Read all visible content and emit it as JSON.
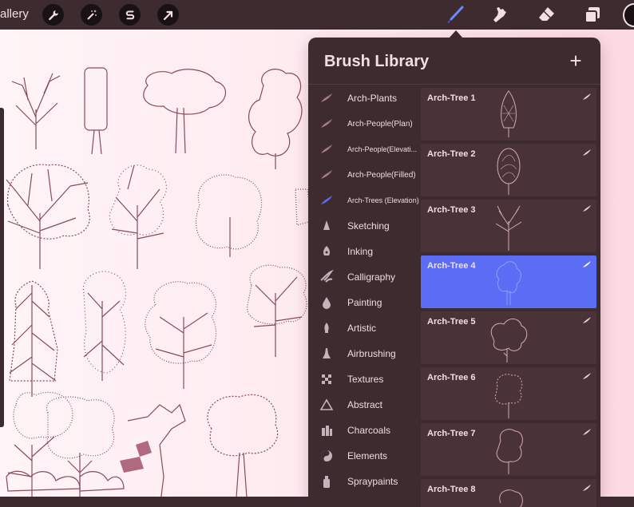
{
  "topbar": {
    "gallery_label": "allery",
    "left_icons": [
      "wrench-icon",
      "magic-wand-icon",
      "selection-s-icon",
      "arrow-cursor-icon"
    ],
    "right_icons": [
      "brush-icon",
      "smudge-icon",
      "eraser-icon",
      "layers-icon"
    ]
  },
  "panel": {
    "title": "Brush Library",
    "add_label": "+"
  },
  "categories": [
    {
      "label": "Arch-Plants",
      "icon": "brush-stroke-icon"
    },
    {
      "label": "Arch-People(Plan)",
      "icon": "brush-stroke-icon"
    },
    {
      "label": "Arch-People(Elevati...",
      "icon": "brush-stroke-icon"
    },
    {
      "label": "Arch-People(Filled)",
      "icon": "brush-stroke-icon"
    },
    {
      "label": "Arch-Trees (Elevation)",
      "icon": "brush-stroke-icon"
    },
    {
      "label": "Sketching",
      "icon": "pencil-tip-icon"
    },
    {
      "label": "Inking",
      "icon": "ink-nib-icon"
    },
    {
      "label": "Calligraphy",
      "icon": "calligraphy-icon"
    },
    {
      "label": "Painting",
      "icon": "paint-drop-icon"
    },
    {
      "label": "Artistic",
      "icon": "flame-brush-icon"
    },
    {
      "label": "Airbrushing",
      "icon": "airbrush-icon"
    },
    {
      "label": "Textures",
      "icon": "texture-grid-icon"
    },
    {
      "label": "Abstract",
      "icon": "triangle-icon"
    },
    {
      "label": "Charcoals",
      "icon": "charcoal-icon"
    },
    {
      "label": "Elements",
      "icon": "yin-yang-icon"
    },
    {
      "label": "Spraypaints",
      "icon": "spray-can-icon"
    }
  ],
  "brushes": [
    {
      "name": "Arch-Tree 1",
      "selected": false
    },
    {
      "name": "Arch-Tree 2",
      "selected": false
    },
    {
      "name": "Arch-Tree 3",
      "selected": false
    },
    {
      "name": "Arch-Tree 4",
      "selected": true
    },
    {
      "name": "Arch-Tree 5",
      "selected": false
    },
    {
      "name": "Arch-Tree 6",
      "selected": false
    },
    {
      "name": "Arch-Tree 7",
      "selected": false
    },
    {
      "name": "Arch-Tree 8",
      "selected": false
    }
  ],
  "colors": {
    "panel_bg": "#3d2b30",
    "selection_blue": "#5b6df5",
    "canvas_pink": "#fde8ee",
    "sketch_stroke": "#8a4a5c",
    "active_tool": "#3f5fe0"
  }
}
